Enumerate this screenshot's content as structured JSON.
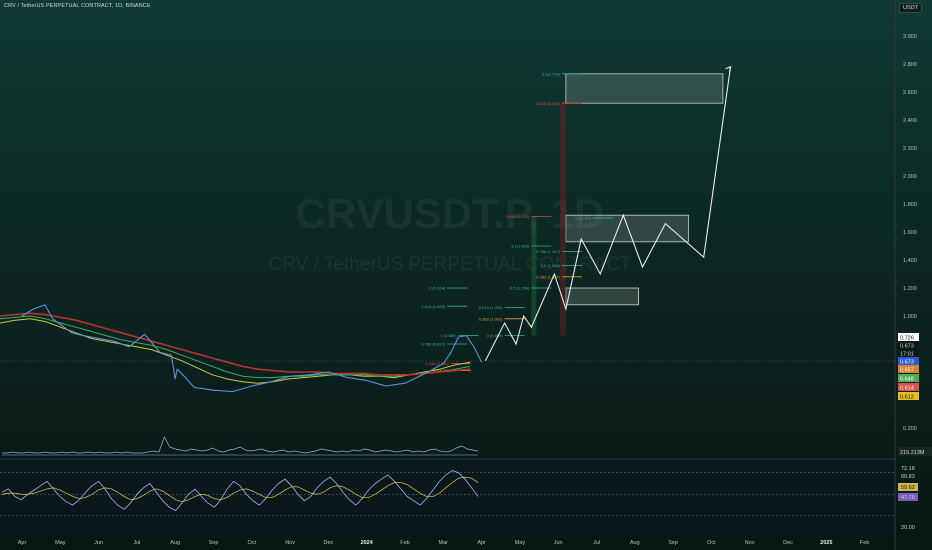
{
  "header": {
    "symbol_title": "CRV / TetherUS PERPETUAL CONTRACT, 1D, BINANCE",
    "currency_badge": "USDT"
  },
  "watermark": {
    "ticker": "CRVUSDT.P, 1D",
    "name": "CRV / TetherUS PERPETUAL CONTRACT"
  },
  "colors": {
    "candle": "#5d8fe0",
    "ema_yellow": "#c9c93c",
    "ema_green": "#3fae62",
    "ema_red": "#b83232",
    "projection": "#e8ecee",
    "fib_teal": "#37b5a0",
    "fib_red": "#e04848",
    "fib_orange": "#e0a030",
    "rsi_line": "#9ab8f0",
    "rsi_signal": "#c9b94a"
  },
  "chart_data": {
    "type": "line",
    "main": {
      "ylim": [
        0.0,
        3.2
      ],
      "price_ticks": [
        "3.000",
        "2.800",
        "2.600",
        "2.400",
        "2.200",
        "2.000",
        "1.800",
        "1.600",
        "1.400",
        "1.200",
        "1.000",
        "0.200"
      ],
      "price_tick_values": [
        3.0,
        2.8,
        2.6,
        2.4,
        2.2,
        2.0,
        1.8,
        1.6,
        1.4,
        1.2,
        1.0,
        0.2
      ],
      "x_labels": [
        "Apr",
        "May",
        "Jun",
        "Jul",
        "Aug",
        "Sep",
        "Oct",
        "Nov",
        "Dec",
        "2024",
        "Feb",
        "Mar",
        "Apr",
        "May",
        "Jun",
        "Jul",
        "Aug",
        "Sep",
        "Oct",
        "Nov",
        "Dec",
        "2025",
        "Feb"
      ],
      "x_label_index": [
        0,
        1,
        2,
        3,
        4,
        5,
        6,
        7,
        8,
        9,
        10,
        11,
        12,
        13,
        14,
        15,
        16,
        17,
        18,
        19,
        20,
        21,
        22
      ],
      "price_series": {
        "name": "CRVUSDT.P",
        "x": [
          0,
          0.3,
          0.6,
          0.8,
          1.0,
          1.3,
          1.6,
          2.0,
          2.4,
          2.8,
          3.2,
          3.6,
          3.9,
          4.0,
          4.05,
          4.2,
          4.5,
          5.0,
          5.5,
          6.0,
          6.5,
          7.0,
          7.5,
          8.0,
          8.5,
          9.0,
          9.5,
          10.0,
          10.3,
          10.6,
          11.0,
          11.2,
          11.4,
          11.6,
          11.8,
          12.0
        ],
        "y": [
          1.0,
          1.05,
          1.08,
          0.98,
          0.94,
          0.88,
          0.86,
          0.84,
          0.82,
          0.78,
          0.87,
          0.74,
          0.72,
          0.55,
          0.62,
          0.58,
          0.49,
          0.47,
          0.46,
          0.5,
          0.53,
          0.57,
          0.58,
          0.6,
          0.56,
          0.54,
          0.5,
          0.52,
          0.56,
          0.6,
          0.66,
          0.74,
          0.85,
          0.86,
          0.78,
          0.67
        ]
      },
      "ema_series": [
        {
          "y": [
            0.95,
            0.97,
            0.98,
            0.96,
            0.92,
            0.88,
            0.84,
            0.82,
            0.8,
            0.78,
            0.76,
            0.72,
            0.68,
            0.63,
            0.58,
            0.55,
            0.53,
            0.52,
            0.53,
            0.55,
            0.56,
            0.57,
            0.58,
            0.58,
            0.57,
            0.57,
            0.56,
            0.58,
            0.6,
            0.62,
            0.65,
            0.67
          ]
        },
        {
          "y": [
            0.98,
            0.99,
            1.0,
            0.98,
            0.95,
            0.92,
            0.89,
            0.86,
            0.83,
            0.81,
            0.79,
            0.76,
            0.72,
            0.68,
            0.64,
            0.6,
            0.57,
            0.56,
            0.56,
            0.57,
            0.57,
            0.58,
            0.58,
            0.58,
            0.58,
            0.57,
            0.57,
            0.58,
            0.59,
            0.6,
            0.62,
            0.64
          ]
        },
        {
          "y": [
            1.0,
            1.01,
            1.02,
            1.01,
            0.99,
            0.97,
            0.94,
            0.91,
            0.88,
            0.85,
            0.82,
            0.79,
            0.76,
            0.73,
            0.7,
            0.67,
            0.64,
            0.62,
            0.61,
            0.6,
            0.6,
            0.6,
            0.59,
            0.59,
            0.59,
            0.58,
            0.58,
            0.58,
            0.59,
            0.6,
            0.61,
            0.62
          ]
        }
      ],
      "projection_path": {
        "x": [
          12.1,
          12.6,
          12.9,
          13.1,
          13.3,
          13.9,
          14.2,
          14.6,
          15.1,
          15.7,
          16.2,
          16.8,
          17.8,
          18.5
        ],
        "y": [
          0.68,
          0.95,
          0.8,
          1.0,
          0.92,
          1.3,
          1.05,
          1.55,
          1.3,
          1.72,
          1.35,
          1.66,
          1.42,
          2.78
        ]
      },
      "target_boxes": [
        {
          "x0": 14.2,
          "x1": 18.3,
          "y0": 2.52,
          "y1": 2.73
        },
        {
          "x0": 14.2,
          "x1": 17.4,
          "y0": 1.53,
          "y1": 1.72
        },
        {
          "x0": 14.2,
          "x1": 16.1,
          "y0": 1.08,
          "y1": 1.2
        }
      ],
      "fib_levels": [
        {
          "label": "3.1(2.726)",
          "y": 2.73,
          "x": 14.1,
          "color": "teal"
        },
        {
          "label": "2.618 (2.520)",
          "y": 2.52,
          "x": 14.1,
          "color": "red"
        },
        {
          "label": "3.618 (1.711)",
          "y": 1.71,
          "x": 13.3,
          "color": "red"
        },
        {
          "label": "3.1(1.6?)",
          "y": 1.7,
          "x": 14.9,
          "color": "teal"
        },
        {
          "label": "3.1(1.503)",
          "y": 1.5,
          "x": 13.3,
          "color": "teal"
        },
        {
          "label": "0.786 (1.45?)",
          "y": 1.46,
          "x": 14.1,
          "color": "teal"
        },
        {
          "label": "0.5 (1.363)",
          "y": 1.36,
          "x": 14.1,
          "color": "teal"
        },
        {
          "label": "0.382 (1.397)",
          "y": 1.28,
          "x": 14.1,
          "color": "orange"
        },
        {
          "label": "2 (1.204)",
          "y": 1.2,
          "x": 11.1,
          "color": "teal"
        },
        {
          "label": "0.5 (1.204)",
          "y": 1.2,
          "x": 13.3,
          "color": "teal"
        },
        {
          "label": "1.618 (1.063)",
          "y": 1.07,
          "x": 11.1,
          "color": "teal"
        },
        {
          "label": "0.618 (1.025)",
          "y": 1.06,
          "x": 12.6,
          "color": "teal"
        },
        {
          "label": "0.382 (1.003)",
          "y": 0.98,
          "x": 12.6,
          "color": "orange"
        },
        {
          "label": "1 (0.860)",
          "y": 0.86,
          "x": 11.4,
          "color": "teal"
        },
        {
          "label": "0.786 (0.822)",
          "y": 0.8,
          "x": 11.1,
          "color": "teal"
        },
        {
          "label": "0 (0.859)",
          "y": 0.86,
          "x": 12.6,
          "color": "teal"
        },
        {
          "label": "0.236 (0.645)",
          "y": 0.66,
          "x": 11.2,
          "color": "red"
        },
        {
          "label": "0.5(0.6?)",
          "y": 0.61,
          "x": 11.2,
          "color": "orange"
        }
      ],
      "price_badges": [
        {
          "label": "0.726",
          "y": 0.726,
          "color": "#ffffff",
          "text": "#111111"
        },
        {
          "label": "0.673",
          "y": 0.673,
          "color": "#0b1a17",
          "text": "#cfd8d6"
        },
        {
          "label": "17:01",
          "y": 0.655,
          "color": "#0b1a17",
          "text": "#cfd8d6"
        },
        {
          "label": "0.673",
          "y": 0.6,
          "color": "#2b5ad8",
          "text": "#ffffff"
        },
        {
          "label": "0.657",
          "y": 0.57,
          "color": "#d9822b",
          "text": "#ffffff"
        },
        {
          "label": "0.648",
          "y": 0.5,
          "color": "#4caf50",
          "text": "#ffffff"
        },
        {
          "label": "0.614",
          "y": 0.43,
          "color": "#d9534f",
          "text": "#ffffff"
        },
        {
          "label": "0.612",
          "y": 0.36,
          "color": "#e0c020",
          "text": "#111111"
        }
      ]
    },
    "volume": {
      "badge": "215.213M",
      "values": [
        2,
        2,
        3,
        2,
        2,
        3,
        2,
        2,
        3,
        2,
        2,
        3,
        2,
        3,
        2,
        2,
        3,
        2,
        3,
        2,
        2,
        3,
        2,
        3,
        2,
        2,
        2,
        3,
        4,
        3,
        18,
        8,
        6,
        5,
        4,
        6,
        5,
        4,
        5,
        7,
        4,
        3,
        5,
        6,
        8,
        5,
        4,
        5,
        6,
        4,
        3,
        4,
        5,
        3,
        4,
        3,
        2,
        3,
        4,
        6,
        5,
        4,
        3,
        4,
        3,
        5,
        4,
        6,
        5,
        3,
        4,
        5,
        4,
        3,
        4,
        5,
        3,
        4,
        3,
        5,
        6,
        4,
        3,
        4,
        7,
        9,
        6,
        5,
        4
      ]
    },
    "rsi": {
      "ticks": [
        "72.18",
        "60.83",
        "59.62",
        "47.76",
        "20.00"
      ],
      "tick_values": [
        72.18,
        60.83,
        59.62,
        47.76,
        20.0
      ],
      "levels": [
        70,
        50,
        30
      ],
      "ylim": [
        15,
        80
      ],
      "values": [
        52,
        55,
        48,
        45,
        50,
        54,
        58,
        62,
        55,
        48,
        43,
        40,
        45,
        52,
        58,
        62,
        55,
        46,
        40,
        36,
        42,
        50,
        56,
        60,
        52,
        44,
        38,
        35,
        42,
        50,
        55,
        48,
        42,
        38,
        45,
        55,
        62,
        58,
        50,
        44,
        40,
        46,
        54,
        60,
        64,
        58,
        50,
        44,
        48,
        56,
        62,
        66,
        60,
        52,
        45,
        40,
        46,
        54,
        60,
        64,
        68,
        62,
        55,
        48,
        44,
        40,
        46,
        54,
        62,
        68,
        72,
        70,
        64,
        56,
        48
      ],
      "signal": [
        50,
        51,
        51,
        50,
        50,
        51,
        53,
        55,
        56,
        54,
        51,
        48,
        46,
        47,
        50,
        54,
        56,
        55,
        52,
        48,
        45,
        46,
        49,
        53,
        55,
        53,
        49,
        45,
        43,
        45,
        48,
        50,
        49,
        46,
        45,
        47,
        51,
        54,
        55,
        53,
        50,
        47,
        47,
        50,
        54,
        57,
        57,
        54,
        51,
        50,
        52,
        56,
        58,
        57,
        54,
        50,
        47,
        47,
        50,
        54,
        58,
        61,
        61,
        59,
        55,
        51,
        48,
        48,
        51,
        56,
        61,
        65,
        66,
        65,
        61
      ]
    }
  }
}
